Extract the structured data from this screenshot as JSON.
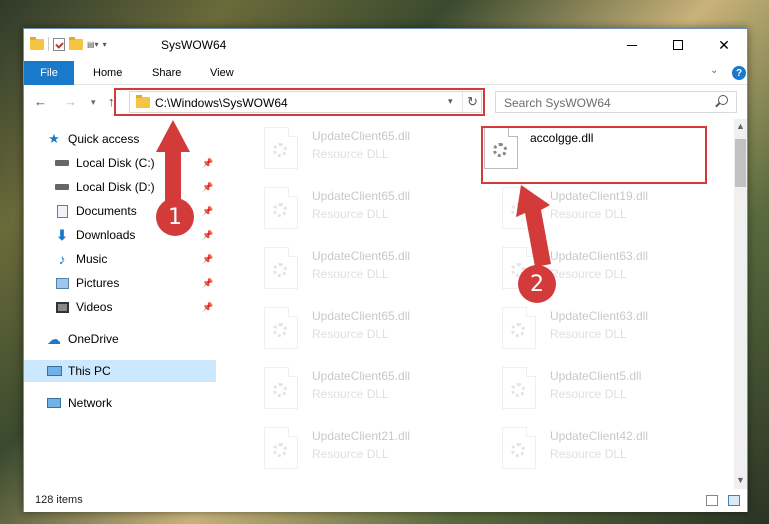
{
  "window": {
    "title": "SysWOW64",
    "controls": {
      "minimize": "minimize-icon",
      "maximize": "maximize-icon",
      "close": "✕"
    }
  },
  "ribbon": {
    "tabs": [
      "File",
      "Home",
      "Share",
      "View"
    ],
    "help": "?"
  },
  "address_bar": {
    "path": "C:\\Windows\\SysWOW64",
    "search_placeholder": "Search SysWOW64"
  },
  "nav_pane": {
    "items": [
      {
        "label": "Quick access",
        "icon": "star-icon"
      },
      {
        "label": "Local Disk (C:)",
        "icon": "drive-icon",
        "pinned": true
      },
      {
        "label": "Local Disk (D:)",
        "icon": "drive-icon",
        "pinned": true
      },
      {
        "label": "Documents",
        "icon": "documents-icon",
        "pinned": true
      },
      {
        "label": "Downloads",
        "icon": "download-icon",
        "pinned": true
      },
      {
        "label": "Music",
        "icon": "music-icon",
        "pinned": true
      },
      {
        "label": "Pictures",
        "icon": "pictures-icon",
        "pinned": true
      },
      {
        "label": "Videos",
        "icon": "video-icon",
        "pinned": true
      },
      {
        "label": "OneDrive",
        "icon": "cloud-icon"
      },
      {
        "label": "This PC",
        "icon": "computer-icon",
        "selected": true
      },
      {
        "label": "Network",
        "icon": "network-icon"
      }
    ]
  },
  "files": {
    "highlighted": {
      "name": "accolgge.dll"
    },
    "left_column": [
      {
        "name": "UpdateClient65.dll",
        "type": "Resource DLL"
      },
      {
        "name": "UpdateClient65.dll",
        "type": "Resource DLL"
      },
      {
        "name": "UpdateClient65.dll",
        "type": "Resource DLL"
      },
      {
        "name": "UpdateClient65.dll",
        "type": "Resource DLL"
      },
      {
        "name": "UpdateClient65.dll",
        "type": "Resource DLL"
      },
      {
        "name": "UpdateClient21.dll",
        "type": "Resource DLL"
      }
    ],
    "right_column": [
      {
        "name": "UpdateClient19.dll",
        "type": "Resource DLL"
      },
      {
        "name": "UpdateClient63.dll",
        "type": "Resource DLL"
      },
      {
        "name": "UpdateClient63.dll",
        "type": "Resource DLL"
      },
      {
        "name": "UpdateClient5.dll",
        "type": "Resource DLL"
      },
      {
        "name": "UpdateClient42.dll",
        "type": "Resource DLL"
      }
    ]
  },
  "status": {
    "item_count": "128 items"
  },
  "annotations": {
    "step1": "1",
    "step2": "2",
    "color": "#d33a3a"
  }
}
